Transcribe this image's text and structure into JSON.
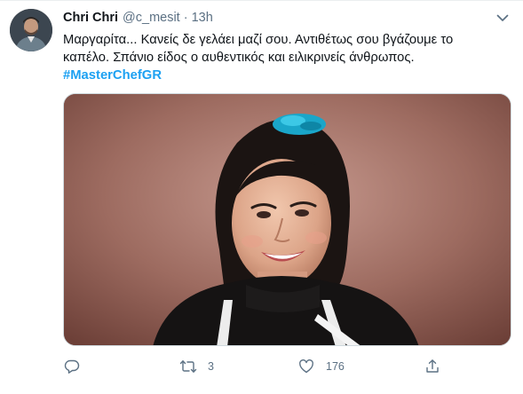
{
  "tweet": {
    "author": {
      "display_name": "Chri Chri",
      "handle": "@c_mesit",
      "separator": "·",
      "timestamp": "13h"
    },
    "text_line_1": "Μαργαρίτα... Κανείς δε γελάει μαζί σου. Αντιθέτως σου βγάζουμε το",
    "text_line_2": "καπέλο. Σπάνιο είδος ο αυθεντικός και ειλικρινείς άνθρωπος.",
    "hashtag": "#MasterChefGR",
    "media_icon": "photo-of-smiling-woman",
    "actions": {
      "reply_icon": "reply-icon",
      "retweet_icon": "retweet-icon",
      "retweet_count": "3",
      "like_icon": "heart-icon",
      "like_count": "176",
      "share_icon": "share-icon"
    },
    "colors": {
      "link": "#1da1f2",
      "secondary_text": "#5b7083",
      "primary_text": "#0f1419"
    }
  }
}
